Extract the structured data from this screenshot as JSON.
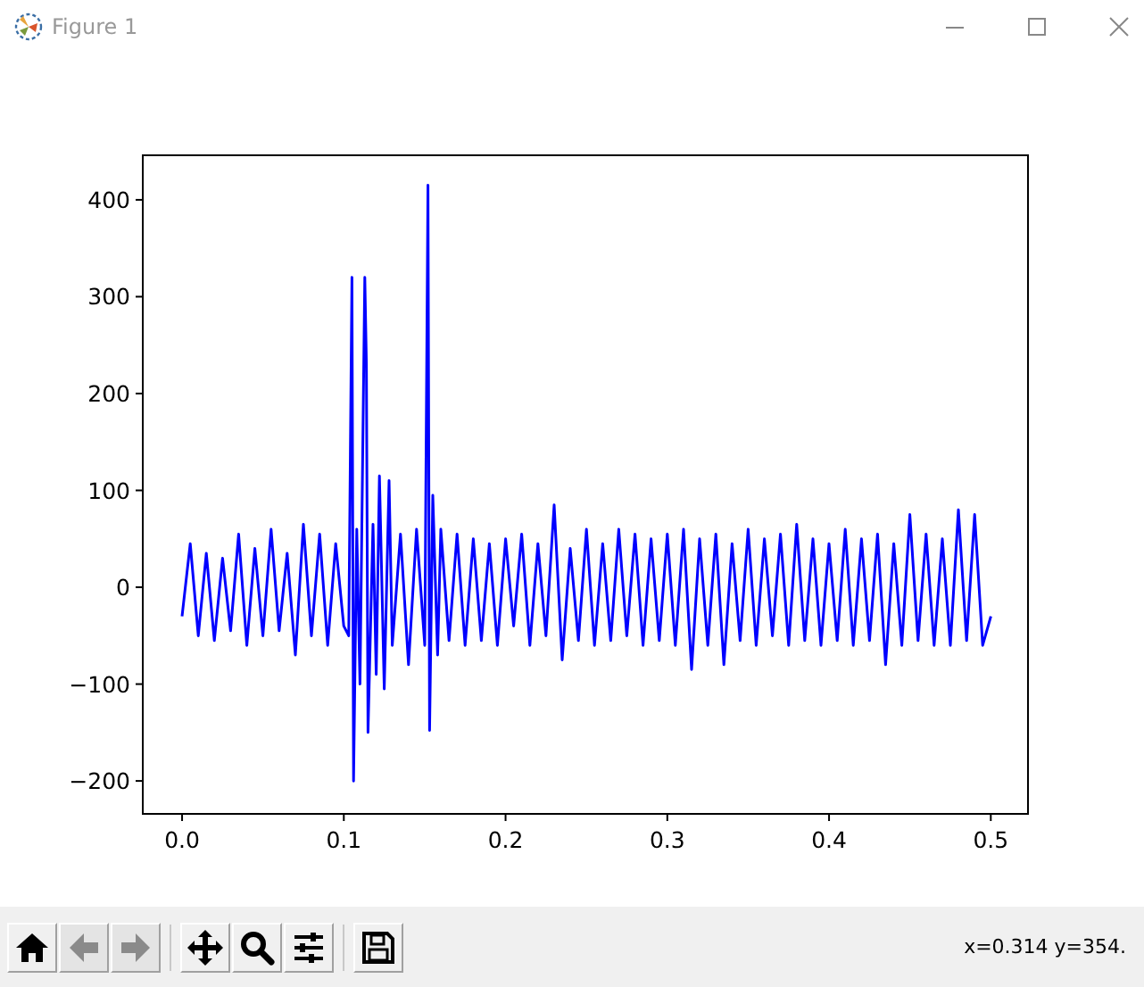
{
  "window": {
    "title": "Figure 1"
  },
  "figure": {
    "chart_data": {
      "type": "line",
      "xlim": [
        -0.0243,
        0.523
      ],
      "ylim": [
        -234,
        446
      ],
      "xticks": [
        {
          "value": 0,
          "label": "0.0"
        },
        {
          "value": 0.1,
          "label": "0.1"
        },
        {
          "value": 0.2,
          "label": "0.2"
        },
        {
          "value": 0.3,
          "label": "0.3"
        },
        {
          "value": 0.4,
          "label": "0.4"
        },
        {
          "value": 0.5,
          "label": "0.5"
        }
      ],
      "yticks": [
        {
          "value": -200,
          "label": "−200"
        },
        {
          "value": -100,
          "label": "−100"
        },
        {
          "value": 0,
          "label": "0"
        },
        {
          "value": 100,
          "label": "100"
        },
        {
          "value": 200,
          "label": "200"
        },
        {
          "value": 300,
          "label": "300"
        },
        {
          "value": 400,
          "label": "400"
        }
      ],
      "x": [
        0,
        0.005,
        0.01,
        0.015,
        0.02,
        0.025,
        0.03,
        0.035,
        0.04,
        0.045,
        0.05,
        0.055,
        0.06,
        0.065,
        0.07,
        0.075,
        0.08,
        0.085,
        0.09,
        0.095,
        0.1,
        0.103,
        0.105,
        0.106,
        0.108,
        0.11,
        0.113,
        0.114,
        0.115,
        0.118,
        0.12,
        0.122,
        0.125,
        0.128,
        0.13,
        0.135,
        0.14,
        0.145,
        0.15,
        0.152,
        0.153,
        0.155,
        0.158,
        0.16,
        0.165,
        0.17,
        0.175,
        0.18,
        0.185,
        0.19,
        0.195,
        0.2,
        0.205,
        0.21,
        0.215,
        0.22,
        0.225,
        0.23,
        0.235,
        0.24,
        0.245,
        0.25,
        0.255,
        0.26,
        0.265,
        0.27,
        0.275,
        0.28,
        0.285,
        0.29,
        0.295,
        0.3,
        0.305,
        0.31,
        0.315,
        0.32,
        0.325,
        0.33,
        0.335,
        0.34,
        0.345,
        0.35,
        0.355,
        0.36,
        0.365,
        0.37,
        0.375,
        0.38,
        0.385,
        0.39,
        0.395,
        0.4,
        0.405,
        0.41,
        0.415,
        0.42,
        0.425,
        0.43,
        0.435,
        0.44,
        0.445,
        0.45,
        0.455,
        0.46,
        0.465,
        0.47,
        0.475,
        0.48,
        0.485,
        0.49,
        0.495,
        0.5
      ],
      "series": [
        {
          "color": "#0000ff",
          "values": [
            -30,
            45,
            -50,
            35,
            -55,
            30,
            -45,
            55,
            -60,
            40,
            -50,
            60,
            -45,
            35,
            -70,
            65,
            -50,
            55,
            -60,
            45,
            -40,
            -50,
            320,
            -200,
            60,
            -100,
            320,
            230,
            -150,
            65,
            -90,
            115,
            -105,
            110,
            -60,
            55,
            -80,
            60,
            -60,
            415,
            -148,
            95,
            -70,
            60,
            -55,
            55,
            -60,
            50,
            -55,
            45,
            -60,
            50,
            -40,
            55,
            -60,
            45,
            -50,
            85,
            -75,
            40,
            -55,
            60,
            -60,
            45,
            -55,
            60,
            -50,
            55,
            -60,
            50,
            -55,
            55,
            -60,
            60,
            -85,
            50,
            -60,
            55,
            -80,
            45,
            -55,
            60,
            -60,
            50,
            -50,
            55,
            -60,
            65,
            -55,
            50,
            -60,
            45,
            -55,
            60,
            -60,
            50,
            -55,
            55,
            -80,
            45,
            -60,
            75,
            -55,
            55,
            -60,
            50,
            -60,
            80,
            -55,
            75,
            -60,
            -30
          ]
        }
      ]
    }
  },
  "toolbar": {
    "groups": [
      [
        {
          "kind": "home",
          "disabled": false
        },
        {
          "kind": "back",
          "disabled": true
        },
        {
          "kind": "forward",
          "disabled": true
        }
      ],
      [
        {
          "kind": "pan",
          "disabled": false
        },
        {
          "kind": "zoom",
          "disabled": false
        },
        {
          "kind": "configure",
          "disabled": false
        }
      ],
      [
        {
          "kind": "save",
          "disabled": false
        }
      ]
    ]
  },
  "status_bar": {
    "text": "x=0.314 y=354."
  }
}
